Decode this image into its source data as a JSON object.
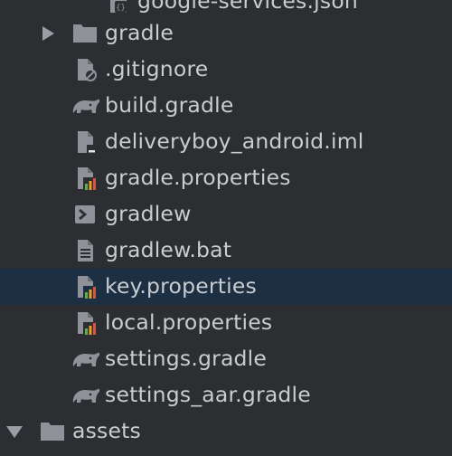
{
  "project_tree": {
    "items": [
      {
        "label": "google-services.json",
        "icon": "json-file-icon"
      },
      {
        "label": "gradle",
        "icon": "folder-icon",
        "expand": "collapsed"
      },
      {
        "label": ".gitignore",
        "icon": "ignore-file-icon"
      },
      {
        "label": "build.gradle",
        "icon": "gradle-elephant-icon"
      },
      {
        "label": "deliveryboy_android.iml",
        "icon": "iml-module-file-icon"
      },
      {
        "label": "gradle.properties",
        "icon": "properties-file-icon"
      },
      {
        "label": "gradlew",
        "icon": "shell-script-icon"
      },
      {
        "label": "gradlew.bat",
        "icon": "text-file-icon"
      },
      {
        "label": "key.properties",
        "icon": "properties-file-icon",
        "selected": true
      },
      {
        "label": "local.properties",
        "icon": "properties-file-icon"
      },
      {
        "label": "settings.gradle",
        "icon": "gradle-elephant-icon"
      },
      {
        "label": "settings_aar.gradle",
        "icon": "gradle-elephant-icon"
      },
      {
        "label": "assets",
        "icon": "folder-icon",
        "expand": "expanded"
      }
    ]
  },
  "colors": {
    "background": "#2c2e31",
    "selection": "#1d2f42",
    "text": "#c9ccd0",
    "icon_gray": "#8f9399"
  }
}
